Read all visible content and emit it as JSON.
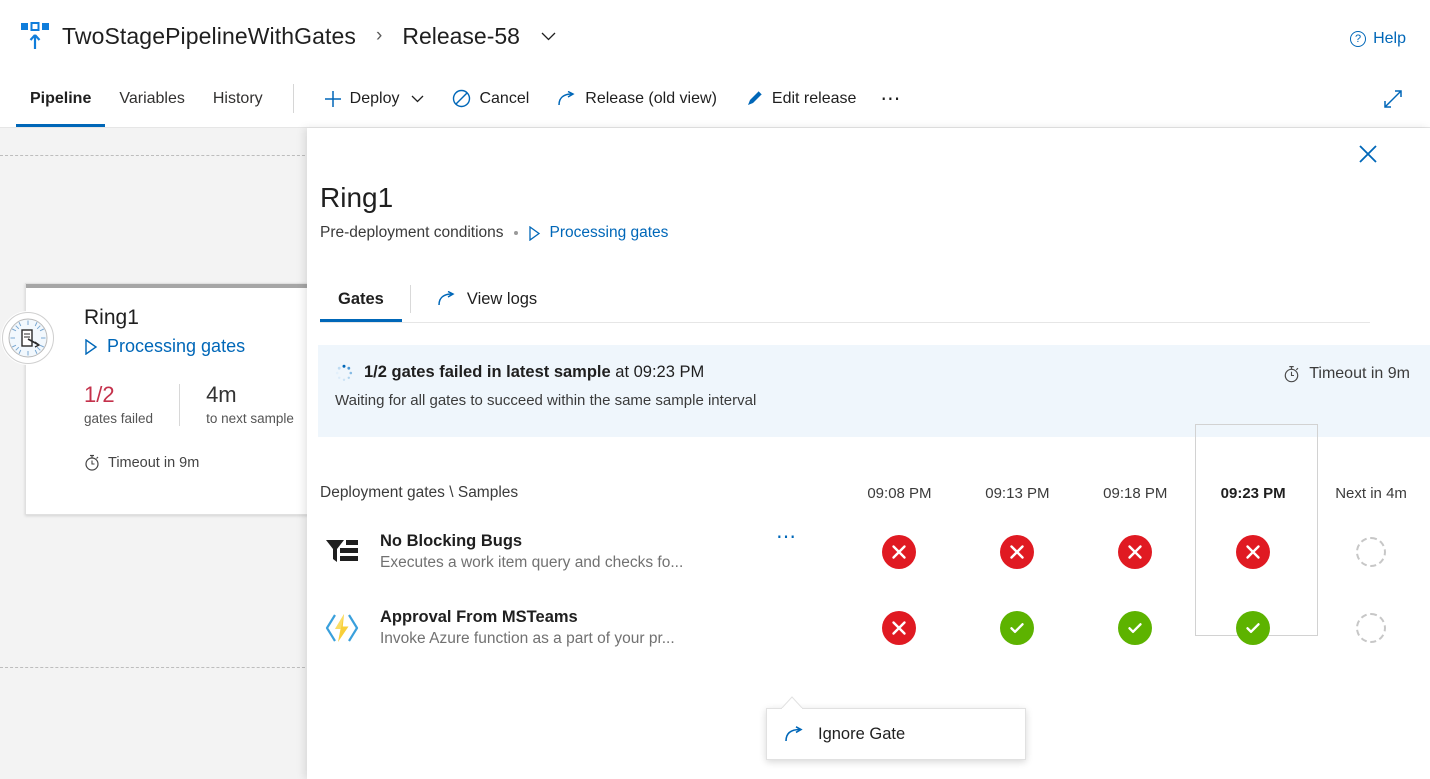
{
  "header": {
    "pipeline_icon": "release-pipeline-icon",
    "pipeline_name": "TwoStagePipelineWithGates",
    "breadcrumb_separator": "›",
    "release_name": "Release-58",
    "release_chevron": "⌄",
    "help_label": "Help"
  },
  "toolbar": {
    "tabs": [
      {
        "label": "Pipeline",
        "active": true
      },
      {
        "label": "Variables",
        "active": false
      },
      {
        "label": "History",
        "active": false
      }
    ],
    "deploy_label": "Deploy",
    "cancel_label": "Cancel",
    "release_old_view_label": "Release (old view)",
    "edit_release_label": "Edit release",
    "more_label": "⋯",
    "expand_icon": "expand-diagonal-icon"
  },
  "stage_card": {
    "badge_icon": "gate-clock-icon",
    "name": "Ring1",
    "status": "Processing gates",
    "status_icon": "play-triangle-icon",
    "metric_failed_value": "1/2",
    "metric_failed_label": "gates failed",
    "metric_next_value": "4m",
    "metric_next_label": "to next sample",
    "timeout_icon": "stopwatch-icon",
    "timeout_label": "Timeout in 9m"
  },
  "panel": {
    "close_icon": "close-icon",
    "title": "Ring1",
    "subtitle": "Pre-deployment conditions",
    "subtitle_link": "Processing gates",
    "subtitle_link_icon": "play-triangle-icon",
    "tabs": [
      {
        "label": "Gates",
        "active": true
      }
    ],
    "view_logs_label": "View logs",
    "view_logs_icon": "open-external-icon"
  },
  "banner": {
    "spinner_icon": "spinner-icon",
    "headline_bold": "1/2 gates failed in latest sample",
    "headline_rest": " at 09:23 PM",
    "subtext": "Waiting for all gates to succeed within the same sample interval",
    "timeout_icon": "stopwatch-icon",
    "timeout_label": "Timeout in 9m",
    "background_color": "#eff6fc"
  },
  "gates_table": {
    "name_column_header": "Deployment gates \\ Samples",
    "sample_columns": [
      {
        "label": "09:08 PM",
        "current": false
      },
      {
        "label": "09:13 PM",
        "current": false
      },
      {
        "label": "09:18 PM",
        "current": false
      },
      {
        "label": "09:23 PM",
        "current": true
      },
      {
        "label": "Next in 4m",
        "current": false
      }
    ],
    "rows": [
      {
        "icon": "work-item-query-icon",
        "title": "No Blocking Bugs",
        "description": "Executes a work item query and checks fo...",
        "more_menu": "⋯",
        "results": [
          "fail",
          "fail",
          "fail",
          "fail",
          "pending"
        ]
      },
      {
        "icon": "azure-function-icon",
        "title": "Approval From MSTeams",
        "description": "Invoke Azure function as a part of your pr...",
        "more_menu": "",
        "results": [
          "fail",
          "pass",
          "pass",
          "pass",
          "pending"
        ]
      }
    ]
  },
  "callout": {
    "icon": "ignore-gate-icon",
    "label": "Ignore Gate"
  },
  "colors": {
    "accent_blue": "#0067b8",
    "fail_red": "#e01a22",
    "pass_green": "#5db300",
    "fail_text_red": "#c4314b",
    "banner_blue": "#eff6fc",
    "canvas_gray": "#f3f3f3"
  }
}
